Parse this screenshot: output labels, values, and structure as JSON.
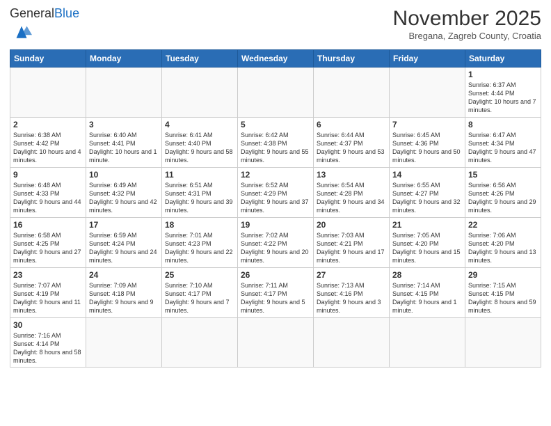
{
  "logo": {
    "general": "General",
    "blue": "Blue"
  },
  "title": "November 2025",
  "subtitle": "Bregana, Zagreb County, Croatia",
  "weekdays": [
    "Sunday",
    "Monday",
    "Tuesday",
    "Wednesday",
    "Thursday",
    "Friday",
    "Saturday"
  ],
  "weeks": [
    [
      {
        "day": "",
        "info": ""
      },
      {
        "day": "",
        "info": ""
      },
      {
        "day": "",
        "info": ""
      },
      {
        "day": "",
        "info": ""
      },
      {
        "day": "",
        "info": ""
      },
      {
        "day": "",
        "info": ""
      },
      {
        "day": "1",
        "info": "Sunrise: 6:37 AM\nSunset: 4:44 PM\nDaylight: 10 hours and 7 minutes."
      }
    ],
    [
      {
        "day": "2",
        "info": "Sunrise: 6:38 AM\nSunset: 4:42 PM\nDaylight: 10 hours and 4 minutes."
      },
      {
        "day": "3",
        "info": "Sunrise: 6:40 AM\nSunset: 4:41 PM\nDaylight: 10 hours and 1 minute."
      },
      {
        "day": "4",
        "info": "Sunrise: 6:41 AM\nSunset: 4:40 PM\nDaylight: 9 hours and 58 minutes."
      },
      {
        "day": "5",
        "info": "Sunrise: 6:42 AM\nSunset: 4:38 PM\nDaylight: 9 hours and 55 minutes."
      },
      {
        "day": "6",
        "info": "Sunrise: 6:44 AM\nSunset: 4:37 PM\nDaylight: 9 hours and 53 minutes."
      },
      {
        "day": "7",
        "info": "Sunrise: 6:45 AM\nSunset: 4:36 PM\nDaylight: 9 hours and 50 minutes."
      },
      {
        "day": "8",
        "info": "Sunrise: 6:47 AM\nSunset: 4:34 PM\nDaylight: 9 hours and 47 minutes."
      }
    ],
    [
      {
        "day": "9",
        "info": "Sunrise: 6:48 AM\nSunset: 4:33 PM\nDaylight: 9 hours and 44 minutes."
      },
      {
        "day": "10",
        "info": "Sunrise: 6:49 AM\nSunset: 4:32 PM\nDaylight: 9 hours and 42 minutes."
      },
      {
        "day": "11",
        "info": "Sunrise: 6:51 AM\nSunset: 4:31 PM\nDaylight: 9 hours and 39 minutes."
      },
      {
        "day": "12",
        "info": "Sunrise: 6:52 AM\nSunset: 4:29 PM\nDaylight: 9 hours and 37 minutes."
      },
      {
        "day": "13",
        "info": "Sunrise: 6:54 AM\nSunset: 4:28 PM\nDaylight: 9 hours and 34 minutes."
      },
      {
        "day": "14",
        "info": "Sunrise: 6:55 AM\nSunset: 4:27 PM\nDaylight: 9 hours and 32 minutes."
      },
      {
        "day": "15",
        "info": "Sunrise: 6:56 AM\nSunset: 4:26 PM\nDaylight: 9 hours and 29 minutes."
      }
    ],
    [
      {
        "day": "16",
        "info": "Sunrise: 6:58 AM\nSunset: 4:25 PM\nDaylight: 9 hours and 27 minutes."
      },
      {
        "day": "17",
        "info": "Sunrise: 6:59 AM\nSunset: 4:24 PM\nDaylight: 9 hours and 24 minutes."
      },
      {
        "day": "18",
        "info": "Sunrise: 7:01 AM\nSunset: 4:23 PM\nDaylight: 9 hours and 22 minutes."
      },
      {
        "day": "19",
        "info": "Sunrise: 7:02 AM\nSunset: 4:22 PM\nDaylight: 9 hours and 20 minutes."
      },
      {
        "day": "20",
        "info": "Sunrise: 7:03 AM\nSunset: 4:21 PM\nDaylight: 9 hours and 17 minutes."
      },
      {
        "day": "21",
        "info": "Sunrise: 7:05 AM\nSunset: 4:20 PM\nDaylight: 9 hours and 15 minutes."
      },
      {
        "day": "22",
        "info": "Sunrise: 7:06 AM\nSunset: 4:20 PM\nDaylight: 9 hours and 13 minutes."
      }
    ],
    [
      {
        "day": "23",
        "info": "Sunrise: 7:07 AM\nSunset: 4:19 PM\nDaylight: 9 hours and 11 minutes."
      },
      {
        "day": "24",
        "info": "Sunrise: 7:09 AM\nSunset: 4:18 PM\nDaylight: 9 hours and 9 minutes."
      },
      {
        "day": "25",
        "info": "Sunrise: 7:10 AM\nSunset: 4:17 PM\nDaylight: 9 hours and 7 minutes."
      },
      {
        "day": "26",
        "info": "Sunrise: 7:11 AM\nSunset: 4:17 PM\nDaylight: 9 hours and 5 minutes."
      },
      {
        "day": "27",
        "info": "Sunrise: 7:13 AM\nSunset: 4:16 PM\nDaylight: 9 hours and 3 minutes."
      },
      {
        "day": "28",
        "info": "Sunrise: 7:14 AM\nSunset: 4:15 PM\nDaylight: 9 hours and 1 minute."
      },
      {
        "day": "29",
        "info": "Sunrise: 7:15 AM\nSunset: 4:15 PM\nDaylight: 8 hours and 59 minutes."
      }
    ],
    [
      {
        "day": "30",
        "info": "Sunrise: 7:16 AM\nSunset: 4:14 PM\nDaylight: 8 hours and 58 minutes."
      },
      {
        "day": "",
        "info": ""
      },
      {
        "day": "",
        "info": ""
      },
      {
        "day": "",
        "info": ""
      },
      {
        "day": "",
        "info": ""
      },
      {
        "day": "",
        "info": ""
      },
      {
        "day": "",
        "info": ""
      }
    ]
  ]
}
